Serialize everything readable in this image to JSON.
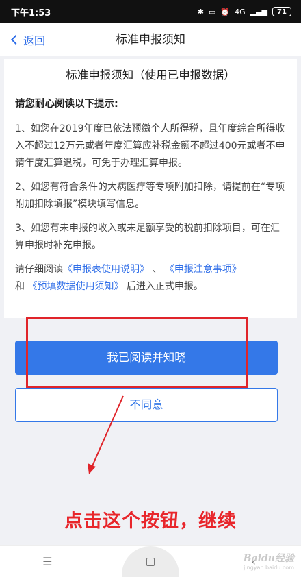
{
  "status_bar": {
    "time": "下午1:53",
    "signal_label": "4G",
    "battery": "71"
  },
  "nav": {
    "back_label": "返回",
    "title": "标准申报须知"
  },
  "notice": {
    "title": "标准申报须知（使用已申报数据）",
    "heading": "请您耐心阅读以下提示:",
    "item1": "1、如您在2019年度已依法预缴个人所得税，且年度综合所得收入不超过12万元或者年度汇算应补税金额不超过400元或者不申请年度汇算退税，可免于办理汇算申报。",
    "item2": "2、如您有符合条件的大病医疗等专项附加扣除，请提前在“专项附加扣除填报”模块填写信息。",
    "item3": "3、如您有未申报的收入或未足额享受的税前扣除项目，可在汇算申报时补充申报。",
    "read_prefix": "请仔细阅读",
    "link1": "《申报表使用说明》",
    "sep": "、",
    "link2": "《申报注意事项》",
    "and": "和",
    "link3": "《预填数据使用须知》",
    "read_suffix": "后进入正式申报。"
  },
  "buttons": {
    "agree": "我已阅读并知晓",
    "disagree": "不同意"
  },
  "annotation": "点击这个按钮，继续",
  "colors": {
    "accent": "#3478e8",
    "annotation_red": "#e8262b"
  },
  "watermark": {
    "brand": "Baidu经验",
    "url": "jingyan.baidu.com"
  }
}
